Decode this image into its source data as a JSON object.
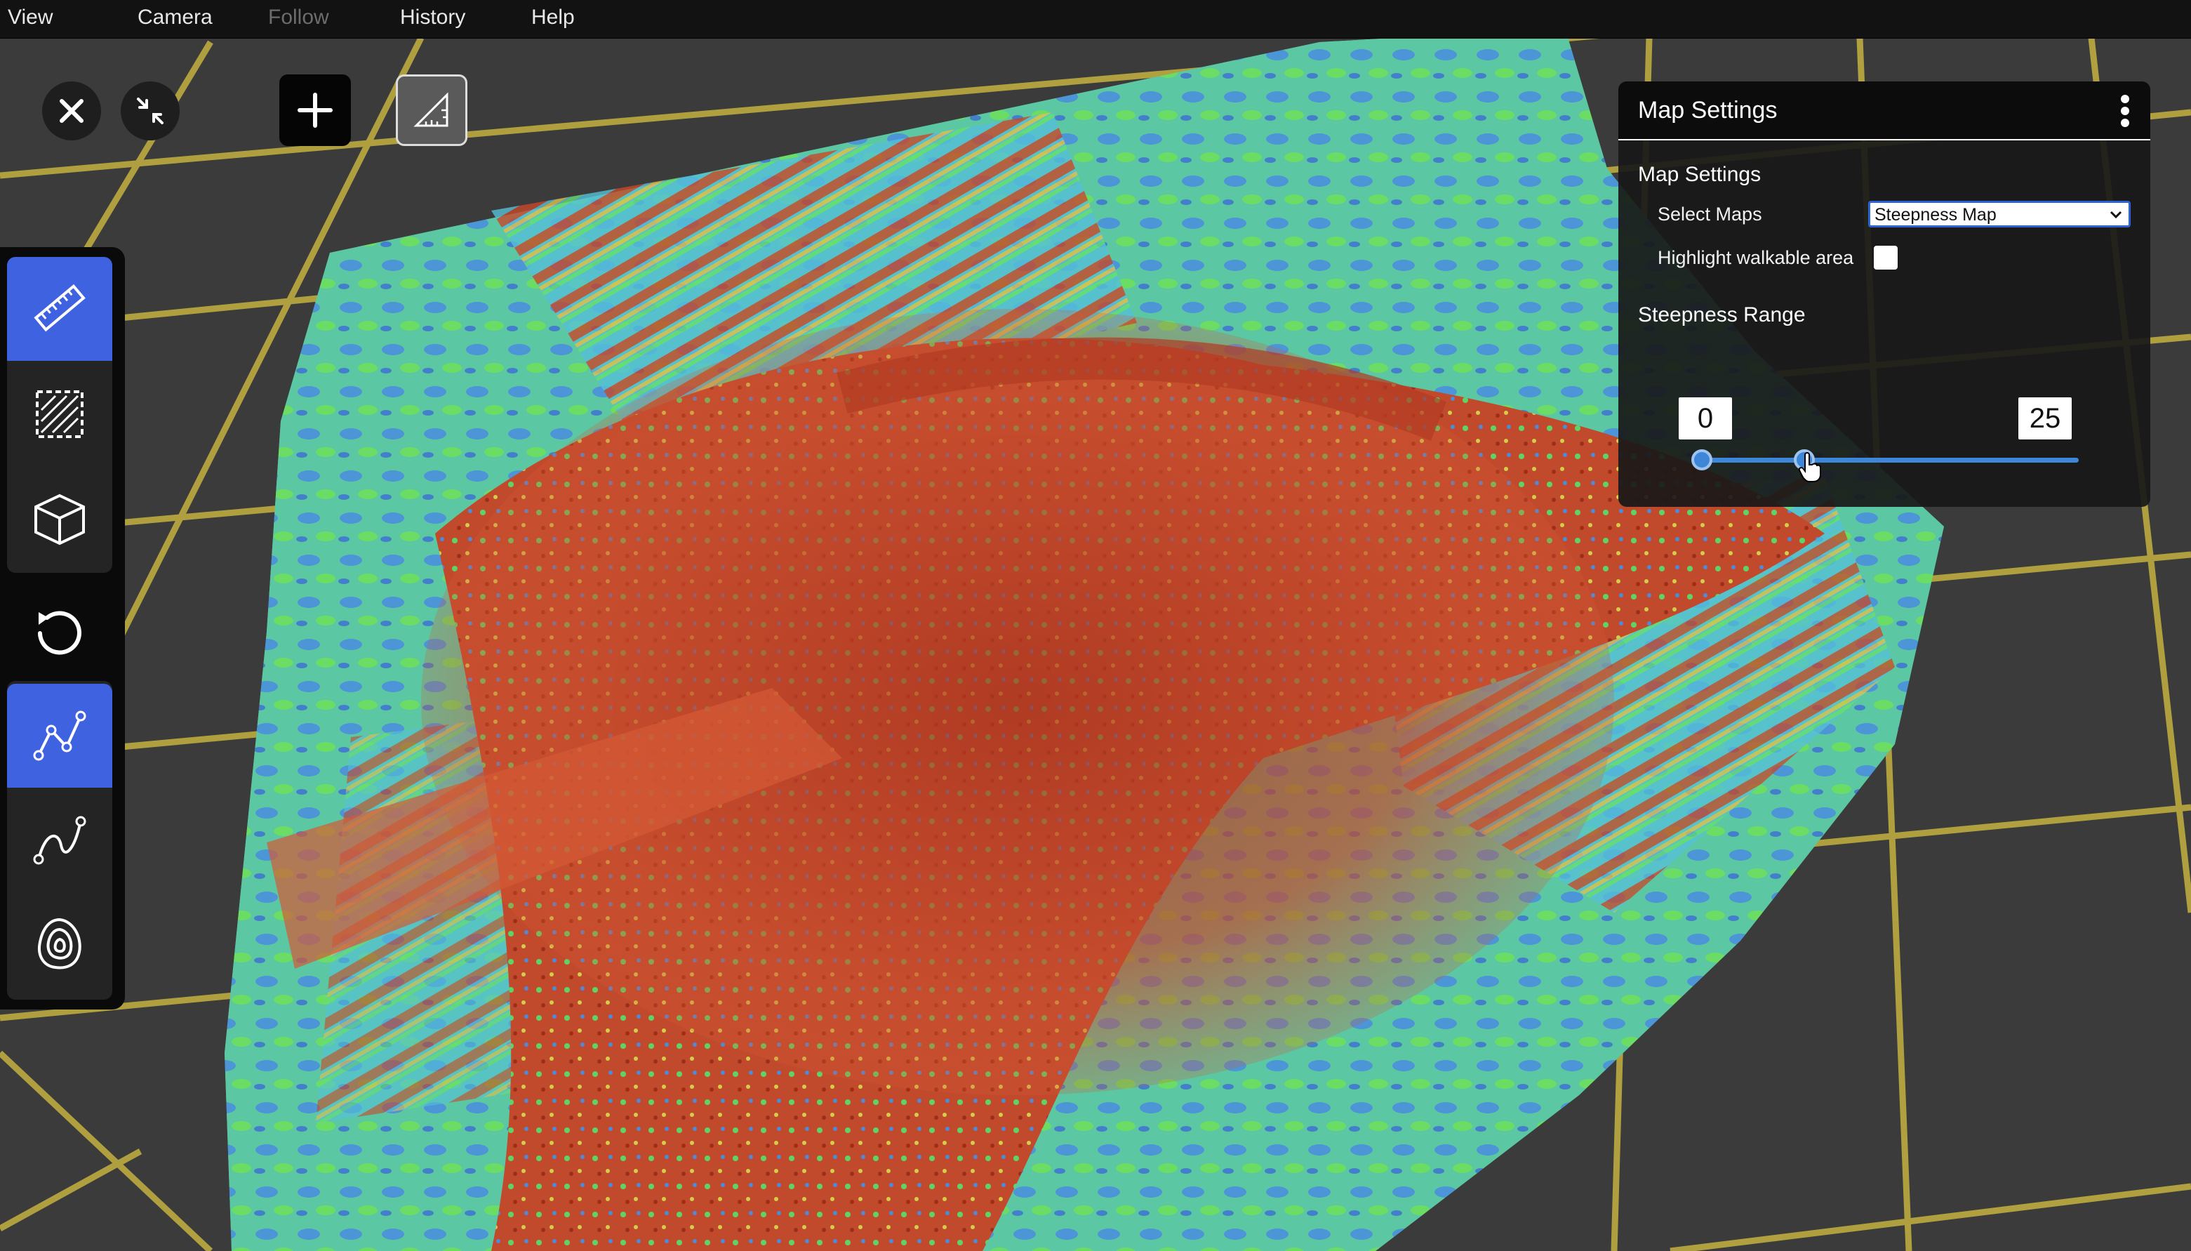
{
  "menu": {
    "items": [
      {
        "label": "View",
        "enabled": true
      },
      {
        "label": "Camera",
        "enabled": true
      },
      {
        "label": "Follow",
        "enabled": false
      },
      {
        "label": "History",
        "enabled": true
      },
      {
        "label": "Help",
        "enabled": true
      }
    ]
  },
  "top_controls": {
    "icons": [
      "close-icon",
      "collapse-icon",
      "add-icon",
      "ruler-triangle-icon"
    ]
  },
  "toolbar": {
    "tools": [
      {
        "icon": "ruler-icon",
        "active": true
      },
      {
        "icon": "hatched-area-icon",
        "active": false
      },
      {
        "icon": "cube-icon",
        "active": false
      },
      {
        "icon": "reset-rotate-icon",
        "active": false
      },
      {
        "icon": "polyline-icon",
        "active": true
      },
      {
        "icon": "curve-icon",
        "active": false
      },
      {
        "icon": "contour-icon",
        "active": false
      }
    ]
  },
  "panel": {
    "title": "Map Settings",
    "section_title": "Map Settings",
    "select_maps_label": "Select Maps",
    "select_maps_value": "Steepness Map",
    "highlight_label": "Highlight walkable area",
    "highlight_checked": false,
    "steepness_title": "Steepness Range",
    "range_min": "0",
    "range_max": "25"
  },
  "colors": {
    "accent": "#3f63e0",
    "slider": "#3d86d8",
    "grid": "#b7a540",
    "steep": "#b8442a",
    "flat_green": "#62d46a",
    "flat_blue": "#4a8de0"
  }
}
